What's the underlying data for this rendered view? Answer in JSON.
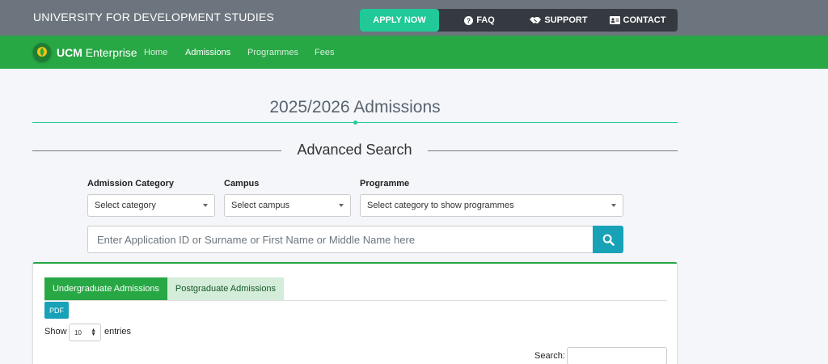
{
  "topbar": {
    "title": "UNIVERSITY FOR DEVELOPMENT STUDIES",
    "menu": {
      "apply": "APPLY NOW",
      "faq": "FAQ",
      "support": "SUPPORT",
      "contact": "CONTACT"
    }
  },
  "navbar": {
    "brand_bold": "UCM",
    "brand_rest": " Enterprise",
    "items": [
      "Home",
      "Admissions",
      "Programmes",
      "Fees"
    ],
    "active": "Admissions"
  },
  "page": {
    "heading": "2025/2026 Admissions",
    "advanced_search": "Advanced Search"
  },
  "filters": {
    "category_label": "Admission Category",
    "category_value": "Select category",
    "campus_label": "Campus",
    "campus_value": "Select campus",
    "programme_label": "Programme",
    "programme_value": "Select category to show programmes",
    "search_placeholder": "Enter Application ID or Surname or First Name or Middle Name here"
  },
  "results": {
    "tab_undergraduate": "Undergraduate Admissions",
    "tab_postgraduate": "Postgraduate Admissions",
    "pdf_label": "PDF",
    "show_label": "Show",
    "entries_value": "10",
    "entries_label": "entries",
    "search_label": "Search:"
  },
  "colors": {
    "topbar": "#6c757d",
    "navbar": "#28a745",
    "accent_teal": "#20c997",
    "info": "#17a2b8"
  }
}
